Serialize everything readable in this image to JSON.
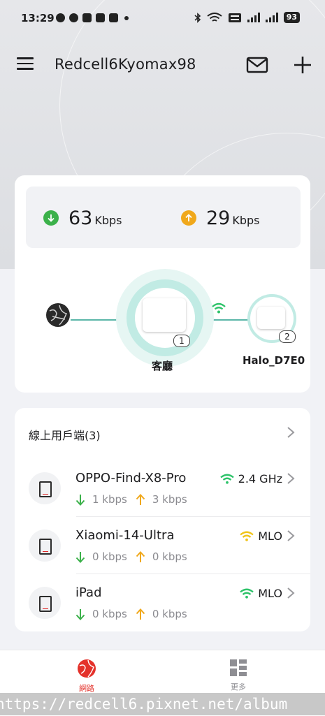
{
  "status_bar": {
    "time": "13:29",
    "battery": "93"
  },
  "header": {
    "title": "Redcell6Kyomax98"
  },
  "speed": {
    "download_value": "63",
    "download_unit": "Kbps",
    "upload_value": "29",
    "upload_unit": "Kbps"
  },
  "topology": {
    "main_node_badge": "1",
    "main_node_name": "客廳",
    "satellite_node_badge": "2",
    "satellite_node_name": "Halo_D7E0"
  },
  "clients": {
    "title": "線上用戶端(3)",
    "items": [
      {
        "name": "OPPO-Find-X8-Pro",
        "band": "2.4 GHz",
        "down": "1 kbps",
        "up": "3 kbps",
        "signal": "strong"
      },
      {
        "name": "Xiaomi-14-Ultra",
        "band": "MLO",
        "down": "0 kbps",
        "up": "0 kbps",
        "signal": "weak"
      },
      {
        "name": "iPad",
        "band": "MLO",
        "down": "0 kbps",
        "up": "0 kbps",
        "signal": "strong"
      }
    ]
  },
  "nav": {
    "network_label": "網路",
    "more_label": "更多"
  },
  "watermark": "https://redcell6.pixnet.net/album",
  "colors": {
    "download": "#3bb14a",
    "upload": "#f0a81b",
    "accent": "#e4322b",
    "teal": "#5bb6a8",
    "wifi_strong": "#2ec36a",
    "wifi_weak": "#f0c419"
  }
}
